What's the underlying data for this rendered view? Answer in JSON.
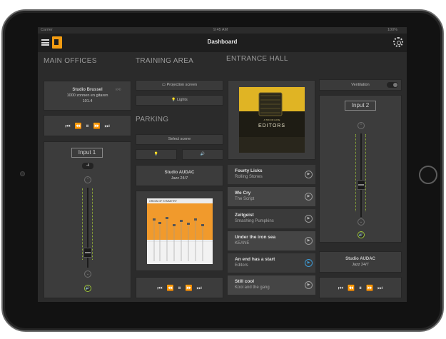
{
  "status": {
    "carrier": "Carrier",
    "time": "9:45 AM",
    "battery": "100%"
  },
  "header": {
    "title": "Dashboard",
    "logo_text": "AUDAC"
  },
  "sections": {
    "main_offices": "MAIN OFFICES",
    "training_area": "TRAINING AREA",
    "entrance_hall": "ENTRANCE HALL",
    "parking": "PARKING"
  },
  "main_offices": {
    "source_name": "Studio Brussel",
    "source_line1": "1000 zonnen en gitaren",
    "source_line2": "101.4",
    "source_badge": "((o))",
    "input_label": "Input 1",
    "volume_value": "-4"
  },
  "training_area": {
    "projection_label": "Projection screen",
    "lights_label": "Lights"
  },
  "parking": {
    "select_scene_label": "Select scene",
    "source_name": "Studio AUDAC",
    "source_sub": "Jazz 24/7",
    "album_title": "ORIGIN OF SYMMETRY"
  },
  "entrance_hall": {
    "album_band": "EDITORS",
    "album_title": "A TON OF LOVE",
    "tracks": [
      {
        "title": "Fourty Licks",
        "artist": "Rolling Stones"
      },
      {
        "title": "We Cry",
        "artist": "The Script"
      },
      {
        "title": "Zeitgeist",
        "artist": "Smashing Pumpkins"
      },
      {
        "title": "Under the iron sea",
        "artist": "KEANE"
      },
      {
        "title": "An end has a start",
        "artist": "Editors"
      },
      {
        "title": "Still cool",
        "artist": "Kool and the gang"
      }
    ]
  },
  "right_column": {
    "ventilation_label": "Ventilation",
    "input_label": "Input 2",
    "source_name": "Studio AUDAC",
    "source_sub": "Jazz 24/7"
  },
  "controls": {
    "prev": "⏮",
    "rew": "⏪",
    "pause": "⏸",
    "ffw": "⏩",
    "next": "⏭"
  },
  "icons": {
    "projector": "▭",
    "bulb": "💡",
    "speaker": "🔊",
    "chev_up": "⌃",
    "chev_down": "⌄"
  }
}
